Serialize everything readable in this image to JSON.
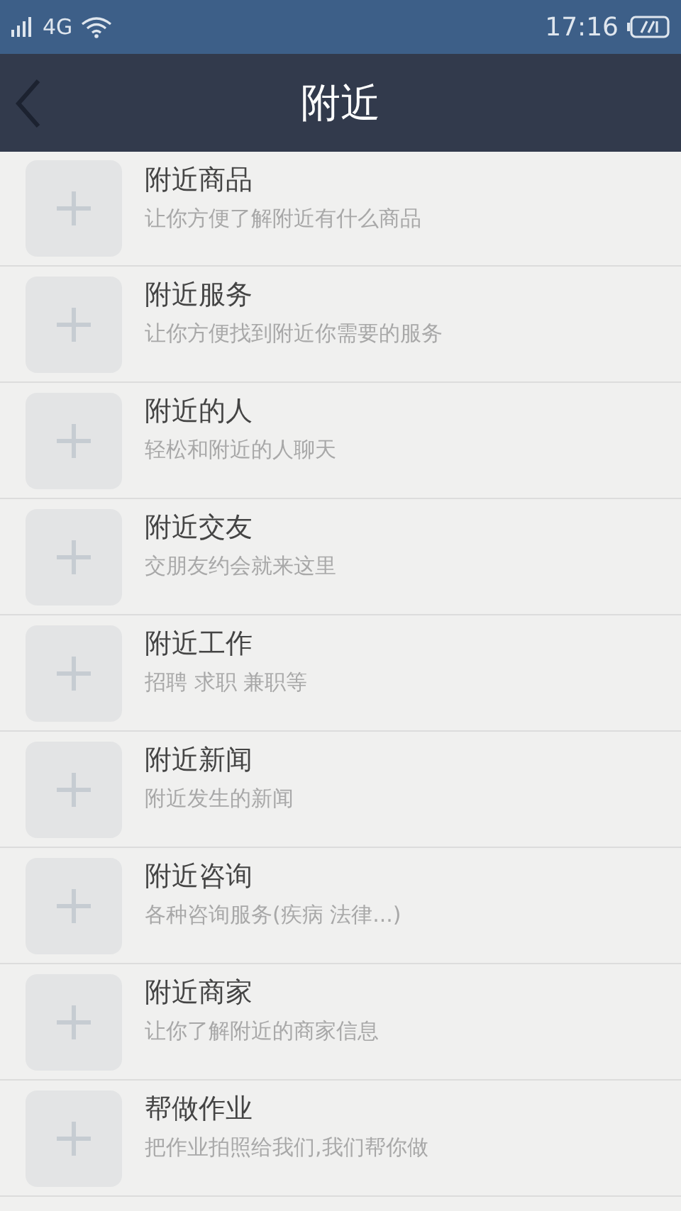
{
  "status_bar": {
    "network": "4G",
    "time": "17:16"
  },
  "header": {
    "title": "附近"
  },
  "items": [
    {
      "title": "附近商品",
      "subtitle": "让你方便了解附近有什么商品"
    },
    {
      "title": "附近服务",
      "subtitle": "让你方便找到附近你需要的服务"
    },
    {
      "title": "附近的人",
      "subtitle": "轻松和附近的人聊天"
    },
    {
      "title": "附近交友",
      "subtitle": "交朋友约会就来这里"
    },
    {
      "title": "附近工作",
      "subtitle": "招聘 求职 兼职等"
    },
    {
      "title": "附近新闻",
      "subtitle": "附近发生的新闻"
    },
    {
      "title": "附近咨询",
      "subtitle": "各种咨询服务(疾病 法律...)"
    },
    {
      "title": "附近商家",
      "subtitle": "让你了解附近的商家信息"
    },
    {
      "title": "帮做作业",
      "subtitle": "把作业拍照给我们,我们帮你做"
    }
  ]
}
